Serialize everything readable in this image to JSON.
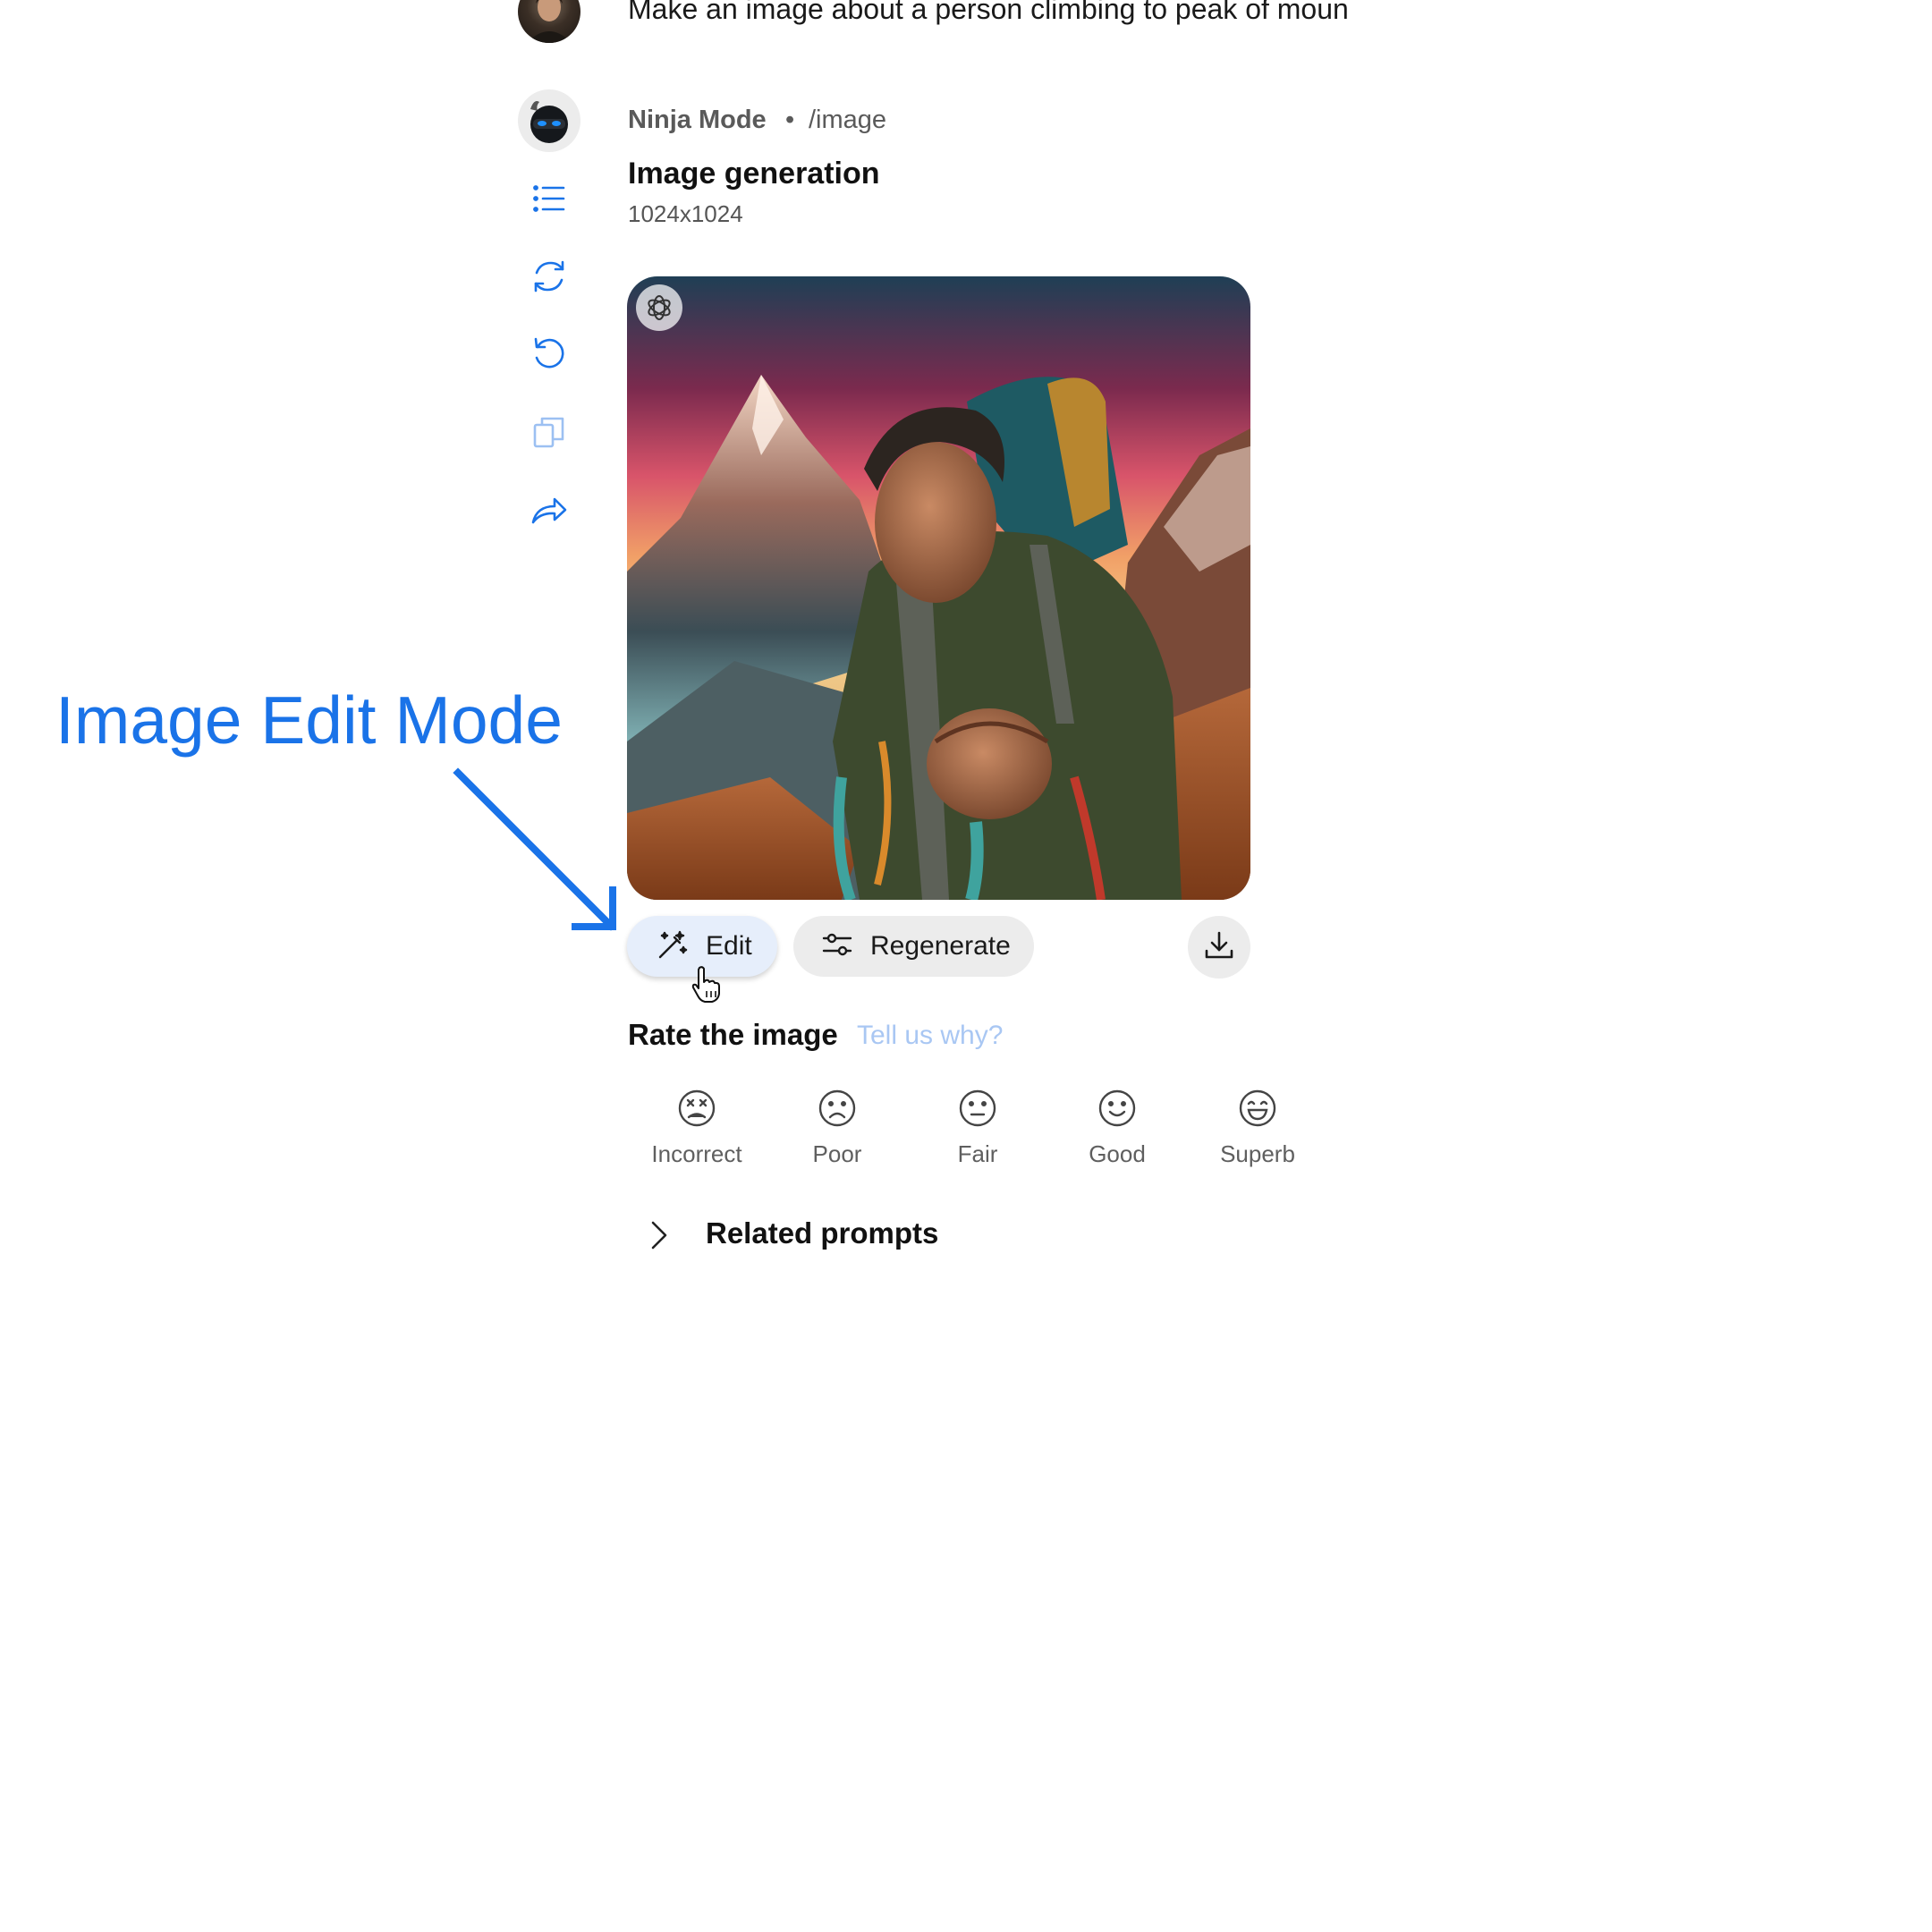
{
  "user_message": {
    "prompt": "Make an image about a person climbing to peak of moun"
  },
  "assistant": {
    "name": "Ninja Mode",
    "separator": "•",
    "command": "/image",
    "title": "Image generation",
    "size": "1024x1024"
  },
  "side_actions": [
    "list-icon",
    "refresh-icon",
    "undo-icon",
    "copy-icon",
    "share-icon"
  ],
  "image": {
    "badge_icon": "openai-logo-icon"
  },
  "actions": {
    "edit_label": "Edit",
    "regenerate_label": "Regenerate",
    "download_icon": "download-icon"
  },
  "annotation": {
    "text": "Image Edit Mode"
  },
  "rating": {
    "title": "Rate the image",
    "why_link": "Tell us why?",
    "options": [
      {
        "label": "Incorrect",
        "icon": "face-dizzy-icon"
      },
      {
        "label": "Poor",
        "icon": "face-sad-icon"
      },
      {
        "label": "Fair",
        "icon": "face-neutral-icon"
      },
      {
        "label": "Good",
        "icon": "face-smile-icon"
      },
      {
        "label": "Superb",
        "icon": "face-grin-icon"
      }
    ]
  },
  "related": {
    "label": "Related prompts"
  },
  "colors": {
    "accent": "#1a73e8",
    "link_muted": "#a9c7f3",
    "edit_button_bg": "#e6eefb",
    "button_bg": "#ececec"
  }
}
